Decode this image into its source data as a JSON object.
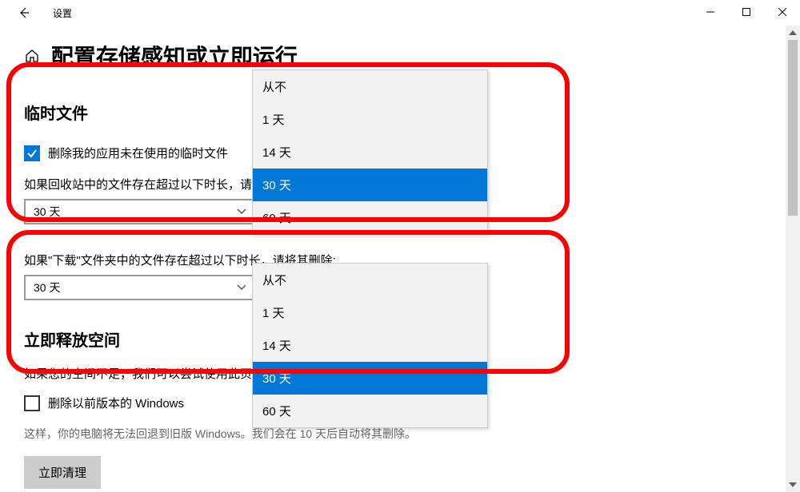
{
  "window": {
    "app_title": "设置",
    "minimize": "—",
    "maximize": "□",
    "close": "✕"
  },
  "page": {
    "title": "配置存储感知或立即运行"
  },
  "temp_files": {
    "heading": "临时文件",
    "checkbox_label": "删除我的应用未在使用的临时文件",
    "recycle_text_prefix": "如果回收站中的文件存在超过以下时长，请",
    "recycle_combo_value": "30 天",
    "downloads_text": "如果\"下载\"文件夹中的文件存在超过以下时长，请将其删除:",
    "downloads_combo_value": "30 天"
  },
  "dropdown_options": {
    "never": "从不",
    "d1": "1 天",
    "d14": "14 天",
    "d30": "30 天",
    "d60": "60 天"
  },
  "free_space": {
    "heading": "立即释放空间",
    "truncated_text": "如果您的空间不足，我们可以尝试使用此页",
    "prev_windows_label": "删除以前版本的 Windows",
    "prev_windows_desc": "这样，你的电脑将无法回退到旧版 Windows。我们会在 10 天后自动将其删除。",
    "clean_now": "立即清理"
  }
}
